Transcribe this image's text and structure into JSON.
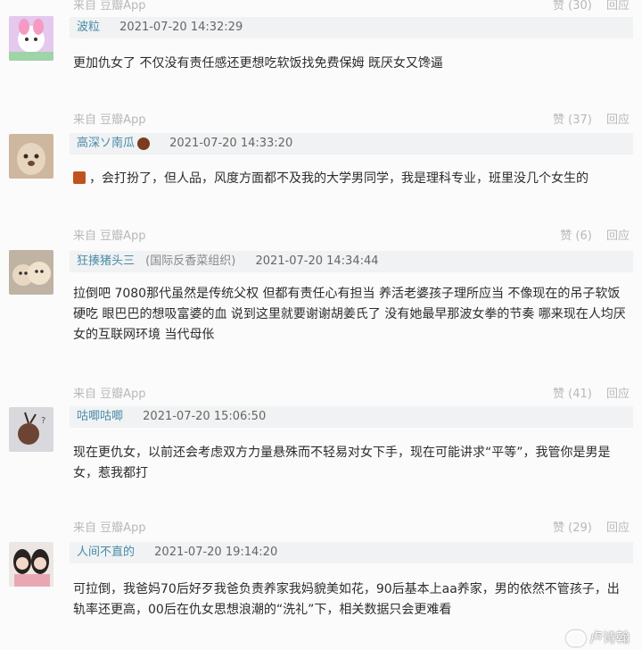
{
  "meta_label": "来自 豆瓣App",
  "reply_label": "回应",
  "comments": [
    {
      "likes": "赞 (30)",
      "username": "波粒",
      "tag": "",
      "time": "2021-07-20 14:32:29",
      "text": "更加仇女了 不仅没有责任感还更想吃软饭找免费保姆 既厌女又馋逼"
    },
    {
      "likes": "赞 (37)",
      "username": "高深ソ南瓜",
      "tag": "",
      "time": "2021-07-20 14:33:20",
      "text": "，会打扮了，但人品，风度方面都不及我的大学男同学，我是理科专业，班里没几个女生的"
    },
    {
      "likes": "赞 (6)",
      "username": "狂揍猪头三",
      "tag": "(国际反香菜组织)",
      "time": "2021-07-20 14:34:44",
      "text": "拉倒吧 7080那代虽然是传统父权 但都有责任心有担当 养活老婆孩子理所应当 不像现在的吊子软饭硬吃 眼巴巴的想吸富婆的血 说到这里就要谢谢胡姜氏了 没有她最早那波女拳的节奏 哪来现在人均厌女的互联网环境 当代母伥"
    },
    {
      "likes": "赞 (41)",
      "username": "咕唧咕唧",
      "tag": "",
      "time": "2021-07-20 15:06:50",
      "text": "现在更仇女，以前还会考虑双方力量悬殊而不轻易对女下手，现在可能讲求“平等”，我管你是男是女，惹我都打"
    },
    {
      "likes": "赞 (29)",
      "username": "人间不直的",
      "tag": "",
      "time": "2021-07-20 19:14:20",
      "text": "可拉倒，我爸妈70后好歹我爸负责养家我妈貌美如花，90后基本上aa养家，男的依然不管孩子，出轨率还更高，00后在仇女思想浪潮的“洗礼”下，相关数据只会更难看"
    }
  ],
  "watermark": "卢诗翰"
}
